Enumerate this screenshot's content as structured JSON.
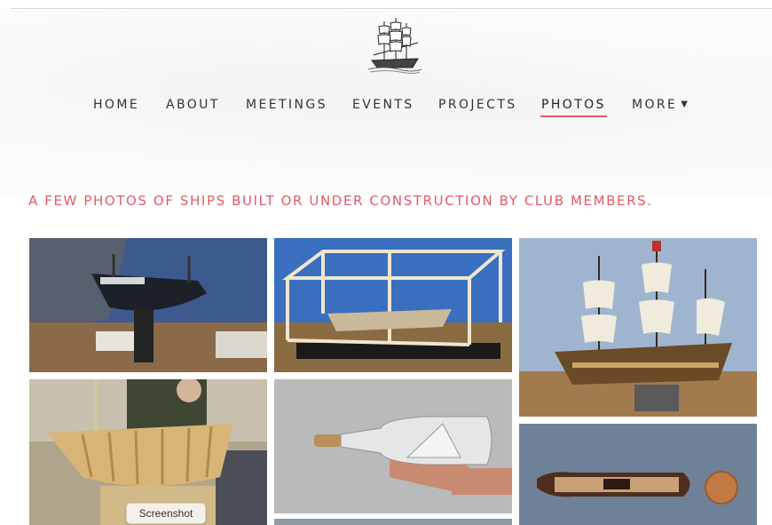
{
  "nav": {
    "items": [
      "HOME",
      "ABOUT",
      "MEETINGS",
      "EVENTS",
      "PROJECTS",
      "PHOTOS",
      "MORE"
    ],
    "active": "PHOTOS"
  },
  "page": {
    "heading": "A FEW PHOTOS OF SHIPS BUILT OR UNDER CONSTRUCTION BY CLUB MEMBERS."
  },
  "tooltip": {
    "label": "Screenshot"
  },
  "colors": {
    "accent": "#e35a66",
    "nav_text": "#333333"
  },
  "icons": {
    "logo": "tall-ship-logo-icon",
    "more": "caret-down-icon"
  }
}
